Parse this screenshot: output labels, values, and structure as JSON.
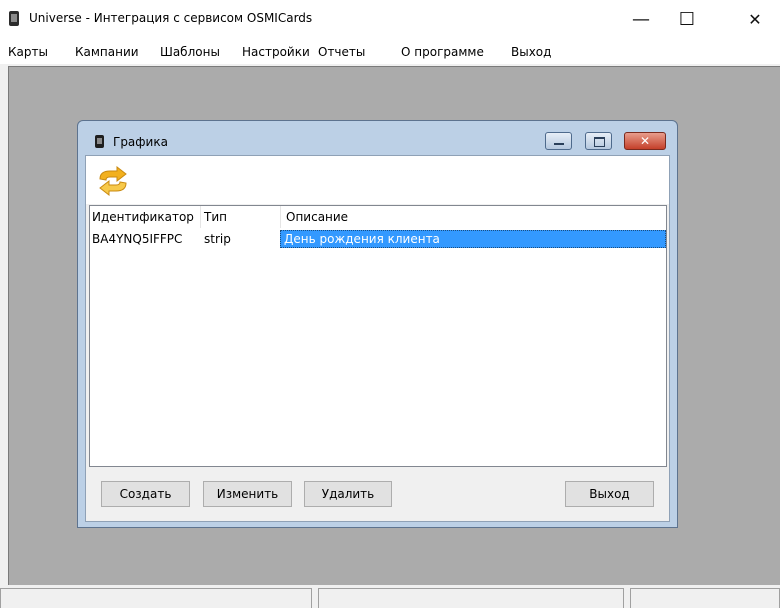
{
  "window": {
    "title": "Universe - Интеграция с сервисом OSMICards",
    "minimize_glyph": "—",
    "maximize_glyph": "☐",
    "close_glyph": "✕"
  },
  "menu": [
    "Карты",
    "Кампании",
    "Шаблоны",
    "Настройки",
    "Отчеты",
    "О программе",
    "Выход"
  ],
  "child_window": {
    "title": "Графика",
    "toolbar": {
      "refresh_icon": "refresh-arrows-icon",
      "icon_color": "#f2b01e"
    },
    "columns": [
      "Идентификатор",
      "Тип",
      "Описание"
    ],
    "rows": [
      {
        "id": "BA4YNQ5IFFPC",
        "type": "strip",
        "description": "День рождения клиента",
        "selected": true
      }
    ],
    "buttons": {
      "create": "Создать",
      "edit": "Изменить",
      "delete": "Удалить",
      "exit": "Выход"
    }
  },
  "colors": {
    "selection": "#3399ff",
    "mdi_background": "#ababab",
    "child_frame": "#bcd0e6",
    "close_button": "#c4402a"
  }
}
